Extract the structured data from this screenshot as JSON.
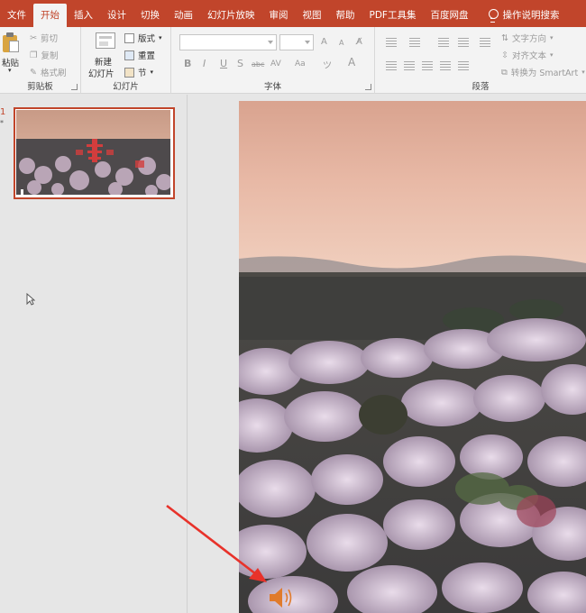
{
  "tabs": [
    {
      "label": "文件",
      "active": false
    },
    {
      "label": "开始",
      "active": true
    },
    {
      "label": "插入",
      "active": false
    },
    {
      "label": "设计",
      "active": false
    },
    {
      "label": "切换",
      "active": false
    },
    {
      "label": "动画",
      "active": false
    },
    {
      "label": "幻灯片放映",
      "active": false
    },
    {
      "label": "审阅",
      "active": false
    },
    {
      "label": "视图",
      "active": false
    },
    {
      "label": "帮助",
      "active": false
    },
    {
      "label": "PDF工具集",
      "active": false
    },
    {
      "label": "百度网盘",
      "active": false
    }
  ],
  "tell_me": "操作说明搜索",
  "ribbon": {
    "clipboard": {
      "paste": "粘贴",
      "cut": "剪切",
      "copy": "复制",
      "format_painter": "格式刷",
      "label": "剪贴板"
    },
    "slides": {
      "new_slide_line1": "新建",
      "new_slide_line2": "幻灯片",
      "layout": "版式",
      "reset": "重置",
      "section": "节",
      "label": "幻灯片"
    },
    "font": {
      "label": "字体",
      "bold": "B",
      "italic": "I",
      "underline": "U",
      "shadow": "S",
      "strike": "abc",
      "spacing": "AV",
      "case": "Aa",
      "color": "A",
      "grow": "A",
      "shrink": "A"
    },
    "paragraph": {
      "text_direction": "文字方向",
      "align_text": "对齐文本",
      "smartart": "转换为 SmartArt",
      "label": "段落"
    }
  },
  "thumbnail": {
    "number": "1",
    "star": "*"
  },
  "colors": {
    "accent": "#c1452b",
    "ribbon_bg": "#f3f3f3",
    "panel_bg": "#e6e6e6",
    "arrow": "#e8322a",
    "speaker": "#e07b2c"
  },
  "icons": [
    "paste-icon",
    "cut-icon",
    "copy-icon",
    "format-painter-icon",
    "new-slide-icon",
    "layout-icon",
    "reset-icon",
    "section-icon",
    "lightbulb-icon",
    "speaker-icon",
    "cursor-icon"
  ]
}
